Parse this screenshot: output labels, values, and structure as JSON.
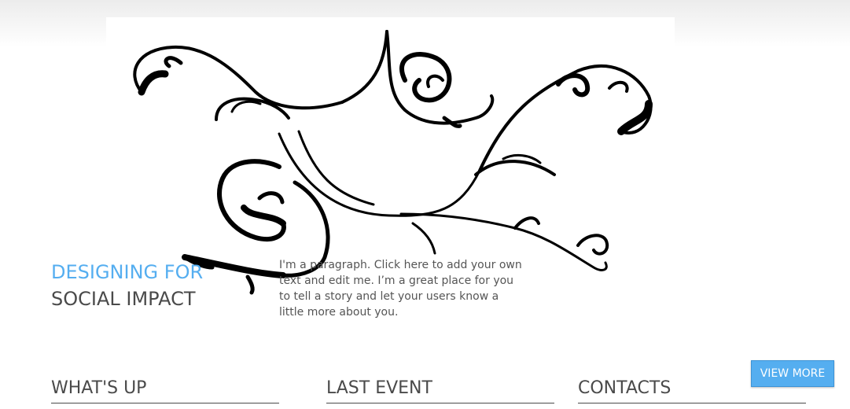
{
  "hero": {
    "title_line1": "DESIGNING FOR",
    "title_line2": "SOCIAL IMPACT",
    "paragraph": "I'm a paragraph. Click here to add your own text and edit me. I’m a great place for you to tell a story and let your users know a little more about you."
  },
  "sections": [
    {
      "title": "WHAT'S UP"
    },
    {
      "title": "LAST EVENT"
    },
    {
      "title": "CONTACTS"
    }
  ],
  "view_more_label": "VIEW MORE",
  "colors": {
    "accent": "#55aef0",
    "heading": "#4a4a4a",
    "text": "#555555"
  }
}
